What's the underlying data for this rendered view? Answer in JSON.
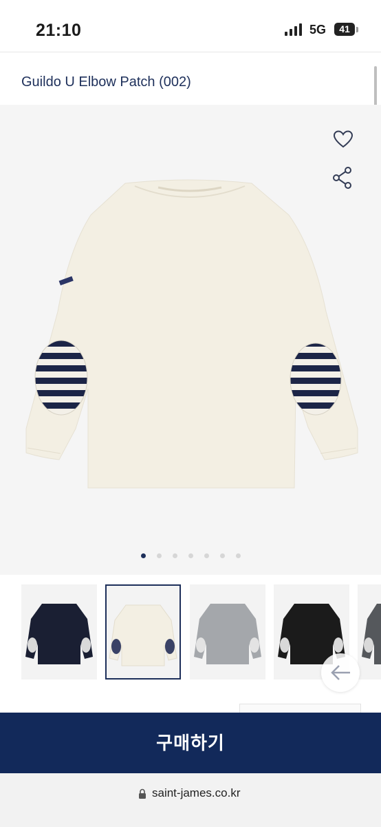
{
  "status_bar": {
    "time": "21:10",
    "network": "5G",
    "battery": "41"
  },
  "product": {
    "title": "Guildo U Elbow Patch (002)"
  },
  "gallery": {
    "total_images": 7,
    "active_index": 0
  },
  "thumbnails": [
    {
      "color": "navy",
      "selected": false
    },
    {
      "color": "ecru",
      "selected": true
    },
    {
      "color": "grey",
      "selected": false
    },
    {
      "color": "black",
      "selected": false
    },
    {
      "color": "dark-grey",
      "selected": false
    }
  ],
  "actions": {
    "buy_label": "구매하기"
  },
  "browser": {
    "url": "saint-james.co.kr"
  },
  "colors": {
    "brand_navy": "#12295a",
    "title_navy": "#1d2f5a"
  }
}
